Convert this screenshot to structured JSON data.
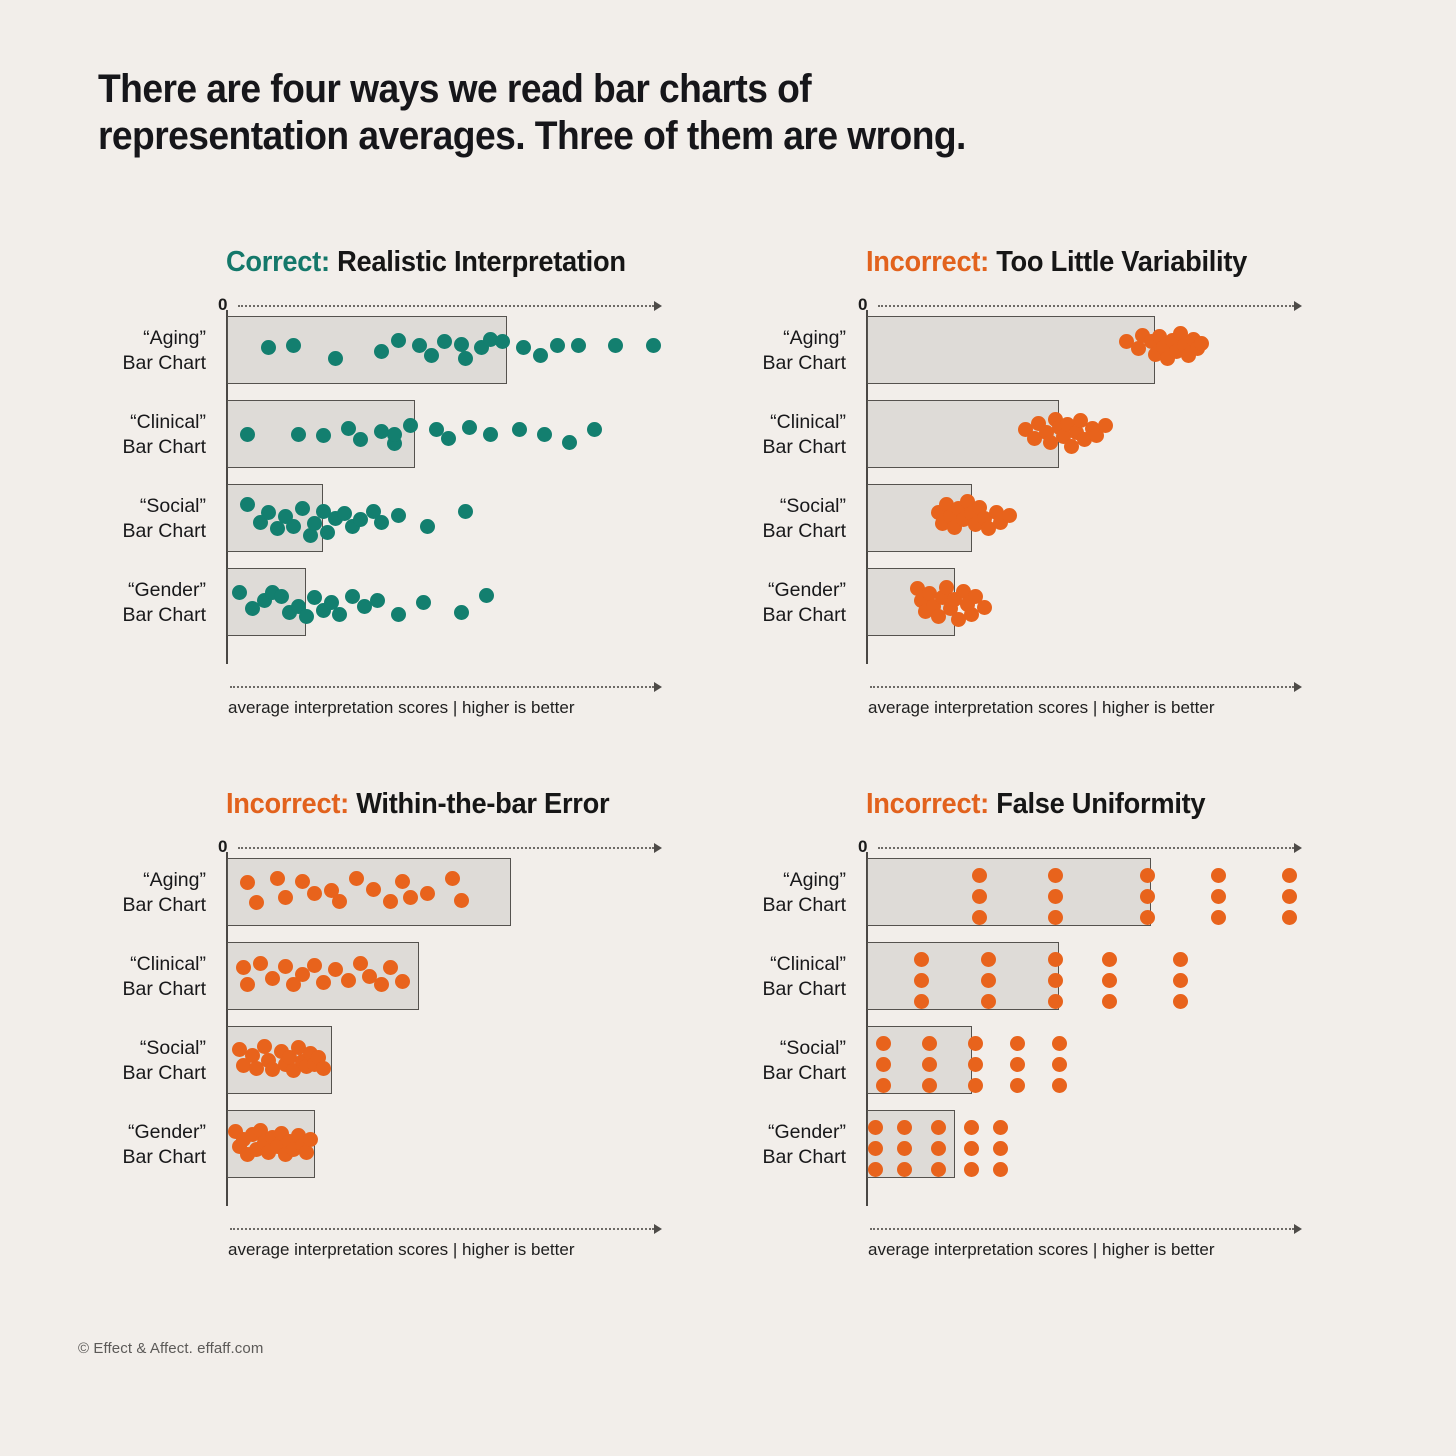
{
  "title": {
    "line1": "There are four ways we read bar charts of",
    "line2": "representation averages. Three of them  are wrong."
  },
  "footer": "© Effect & Affect. effaff.com",
  "common": {
    "zero_label": "0",
    "axis_caption": "average interpretation scores | higher is better",
    "categories": [
      {
        "name": "“Aging”",
        "sub": "Bar Chart"
      },
      {
        "name": "“Clinical”",
        "sub": "Bar Chart"
      },
      {
        "name": "“Social”",
        "sub": "Bar Chart"
      },
      {
        "name": "“Gender”",
        "sub": "Bar Chart"
      }
    ],
    "colors": {
      "background": "#f2eeea",
      "teal": "#137f6f",
      "orange": "#e8631c",
      "bar_fill": "#dedbd7",
      "bar_stroke": "#55524e",
      "text": "#16161a"
    }
  },
  "panels": [
    {
      "id": "realistic-interpretation",
      "verdict": "Correct:",
      "verdict_kind": "correct",
      "label": "Realistic Interpretation",
      "chart_data": {
        "type": "bar",
        "title": "Correct: Realistic Interpretation",
        "xlabel": "average interpretation scores | higher is better",
        "ylabel": "",
        "grid": false,
        "legend": "none",
        "xlim": [
          0,
          100
        ],
        "categories": [
          "“Aging” Bar Chart",
          "“Clinical” Bar Chart",
          "“Social” Bar Chart",
          "“Gender” Bar Chart"
        ],
        "values": [
          67,
          45,
          23,
          19
        ],
        "overlay": "dots-wide-spread",
        "points": [
          [
            10,
            46,
            16,
            44,
            26,
            62,
            37,
            52,
            41,
            36,
            46,
            44,
            49,
            58,
            52,
            38,
            56,
            42,
            57,
            62,
            61,
            46,
            63,
            34,
            66,
            38,
            71,
            46,
            75,
            58,
            79,
            44,
            84,
            44,
            93,
            44,
            102,
            44
          ],
          [
            5,
            50,
            17,
            50,
            23,
            52,
            29,
            42,
            32,
            58,
            37,
            46,
            40,
            64,
            40,
            50,
            44,
            38,
            50,
            44,
            53,
            56,
            58,
            40,
            63,
            50,
            70,
            44,
            76,
            50,
            82,
            62,
            88,
            44
          ],
          [
            5,
            30,
            8,
            56,
            10,
            42,
            12,
            66,
            14,
            48,
            16,
            62,
            18,
            36,
            20,
            75,
            21,
            58,
            23,
            40,
            24,
            72,
            26,
            50,
            28,
            44,
            30,
            62,
            32,
            52,
            35,
            40,
            37,
            56,
            41,
            46,
            48,
            62,
            57,
            40
          ],
          [
            3,
            36,
            6,
            60,
            9,
            48,
            11,
            36,
            13,
            42,
            15,
            66,
            17,
            56,
            19,
            72,
            21,
            44,
            23,
            62,
            25,
            50,
            27,
            68,
            30,
            42,
            33,
            56,
            36,
            48,
            41,
            68,
            47,
            50,
            56,
            66,
            62,
            40
          ]
        ]
      }
    },
    {
      "id": "too-little-variability",
      "verdict": "Incorrect:",
      "verdict_kind": "incorrect",
      "label": "Too Little Variability",
      "chart_data": {
        "type": "bar",
        "title": "Incorrect: Too Little Variability",
        "xlabel": "average interpretation scores | higher is better",
        "ylabel": "",
        "grid": false,
        "legend": "none",
        "xlim": [
          0,
          100
        ],
        "categories": [
          "“Aging” Bar Chart",
          "“Clinical” Bar Chart",
          "“Social” Bar Chart",
          "“Gender” Bar Chart"
        ],
        "values": [
          69,
          46,
          25,
          21
        ],
        "overlay": "dots-tight-cluster-at-bar-end",
        "cluster_center": [
          69,
          46,
          25,
          21
        ],
        "cluster_spread_x": 5,
        "points": [
          [
            62,
            38,
            65,
            48,
            66,
            28,
            68,
            38,
            69,
            56,
            70,
            30,
            71,
            46,
            72,
            62,
            73,
            36,
            74,
            52,
            75,
            26,
            76,
            44,
            77,
            58,
            78,
            34,
            79,
            48,
            80,
            40
          ],
          [
            38,
            44,
            40,
            56,
            41,
            34,
            43,
            48,
            44,
            62,
            45,
            28,
            46,
            40,
            47,
            54,
            48,
            36,
            49,
            68,
            50,
            48,
            51,
            30,
            52,
            58,
            54,
            42,
            55,
            52,
            57,
            38
          ],
          [
            17,
            42,
            18,
            58,
            19,
            30,
            20,
            48,
            21,
            64,
            22,
            36,
            23,
            52,
            24,
            26,
            25,
            44,
            26,
            60,
            27,
            34,
            28,
            50,
            29,
            66,
            31,
            42,
            32,
            56,
            34,
            46
          ],
          [
            12,
            30,
            13,
            48,
            14,
            64,
            15,
            38,
            16,
            56,
            17,
            72,
            18,
            44,
            19,
            28,
            20,
            60,
            21,
            46,
            22,
            76,
            23,
            34,
            24,
            54,
            25,
            68,
            26,
            42,
            28,
            58
          ]
        ]
      }
    },
    {
      "id": "within-the-bar-error",
      "verdict": "Incorrect:",
      "verdict_kind": "incorrect",
      "label": "Within-the-bar Error",
      "chart_data": {
        "type": "bar",
        "title": "Incorrect: Within-the-bar Error",
        "xlabel": "average interpretation scores | higher is better",
        "ylabel": "",
        "grid": false,
        "legend": "none",
        "xlim": [
          0,
          100
        ],
        "categories": [
          "“Aging” Bar Chart",
          "“Clinical” Bar Chart",
          "“Social” Bar Chart",
          "“Gender” Bar Chart"
        ],
        "values": [
          68,
          46,
          25,
          21
        ],
        "overlay": "dots-uniform-inside-bar-only",
        "points": [
          [
            5,
            36,
            7,
            66,
            12,
            30,
            14,
            58,
            18,
            34,
            21,
            52,
            25,
            48,
            27,
            64,
            31,
            30,
            35,
            46,
            39,
            64,
            42,
            34,
            44,
            58,
            48,
            52,
            54,
            30,
            56,
            62
          ],
          [
            4,
            38,
            5,
            62,
            8,
            32,
            11,
            54,
            14,
            36,
            16,
            62,
            18,
            48,
            21,
            34,
            23,
            60,
            26,
            40,
            29,
            56,
            32,
            32,
            34,
            50,
            37,
            62,
            39,
            38,
            42,
            58
          ],
          [
            3,
            34,
            4,
            58,
            6,
            44,
            7,
            62,
            9,
            30,
            10,
            50,
            11,
            64,
            13,
            38,
            14,
            56,
            15,
            46,
            16,
            66,
            17,
            32,
            18,
            52,
            19,
            60,
            20,
            40,
            21,
            56,
            22,
            46,
            23,
            62
          ],
          [
            2,
            32,
            3,
            54,
            4,
            44,
            5,
            66,
            6,
            36,
            7,
            58,
            8,
            30,
            9,
            48,
            10,
            62,
            11,
            40,
            12,
            54,
            13,
            34,
            14,
            66,
            15,
            46,
            16,
            58,
            17,
            38,
            18,
            52,
            19,
            62,
            20,
            44
          ]
        ]
      }
    },
    {
      "id": "false-uniformity",
      "verdict": "Incorrect:",
      "verdict_kind": "incorrect",
      "label": "False Uniformity",
      "chart_data": {
        "type": "bar",
        "title": "Incorrect: False Uniformity",
        "xlabel": "average interpretation scores | higher is better",
        "ylabel": "",
        "grid": false,
        "legend": "none",
        "xlim": [
          0,
          100
        ],
        "categories": [
          "“Aging” Bar Chart",
          "“Clinical” Bar Chart",
          "“Social” Bar Chart",
          "“Gender” Bar Chart"
        ],
        "values": [
          68,
          46,
          25,
          21
        ],
        "overlay": "dots-regular-grid-columns",
        "grid_columns": [
          [
            27,
            45,
            67,
            84,
            101
          ],
          [
            13,
            29,
            45,
            58,
            75
          ],
          [
            4,
            15,
            26,
            36,
            46
          ],
          [
            2,
            9,
            17,
            25,
            32
          ]
        ],
        "rows_per_column": 3
      }
    }
  ]
}
